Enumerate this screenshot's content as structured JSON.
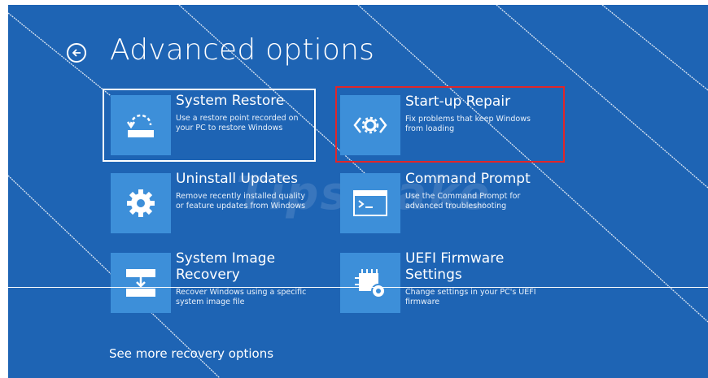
{
  "header": {
    "title": "Advanced options",
    "back_icon": "back-arrow-icon"
  },
  "options": [
    {
      "title": "System Restore",
      "description": "Use a restore point recorded on your PC to restore Windows",
      "icon": "system-restore-icon"
    },
    {
      "title": "Start-up Repair",
      "description": "Fix problems that keep Windows from loading",
      "icon": "startup-repair-icon"
    },
    {
      "title": "Uninstall Updates",
      "description": "Remove recently installed quality or feature updates from Windows",
      "icon": "gear-icon"
    },
    {
      "title": "Command Prompt",
      "description": "Use the Command Prompt for advanced troubleshooting",
      "icon": "command-prompt-icon"
    },
    {
      "title": "System Image Recovery",
      "description": "Recover Windows using a specific system image file",
      "icon": "system-image-icon"
    },
    {
      "title": "UEFI Firmware Settings",
      "description": "Change settings in your PC's UEFI firmware",
      "icon": "firmware-chip-icon"
    }
  ],
  "footer": {
    "more_link": "See more recovery options"
  },
  "watermark": "TipsMake",
  "colors": {
    "background": "#1e64b4",
    "tile_icon_bg": "#3d8fd9",
    "highlight": "#e0262a"
  }
}
